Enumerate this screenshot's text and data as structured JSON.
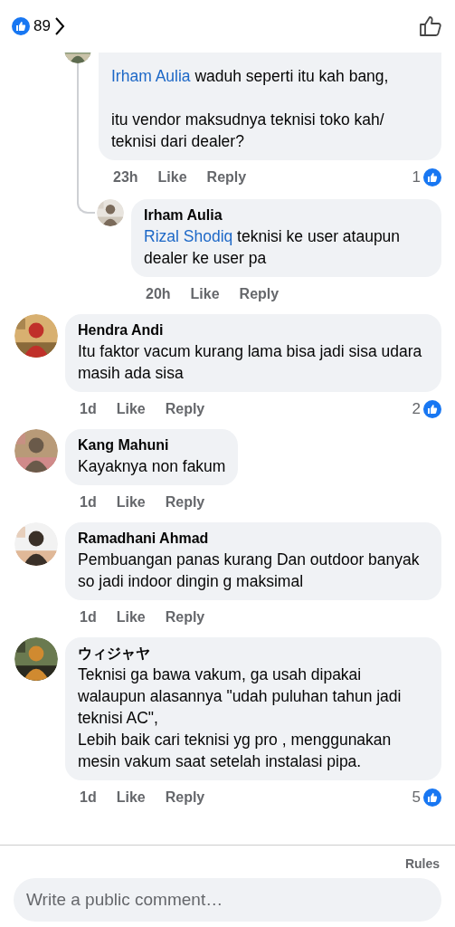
{
  "header": {
    "reaction_count": "89"
  },
  "thread": [
    {
      "mention": "Irham Aulia",
      "text": " waduh seperti itu kah bang,\n\nitu vendor maksudnya teknisi toko kah/ teknisi dari dealer?",
      "time": "23h",
      "actions": [
        "Like",
        "Reply"
      ],
      "reaction_count": "1",
      "children": [
        {
          "name": "Irham Aulia",
          "mention": "Rizal Shodiq",
          "text": " teknisi ke user ataupun dealer ke user pa",
          "time": "20h",
          "actions": [
            "Like",
            "Reply"
          ]
        }
      ]
    }
  ],
  "comments": [
    {
      "name": "Hendra Andi",
      "text": "Itu faktor vacum kurang lama bisa jadi sisa udara masih ada sisa",
      "time": "1d",
      "actions": [
        "Like",
        "Reply"
      ],
      "reaction_count": "2"
    },
    {
      "name": "Kang Mahuni",
      "text": "Kayaknya non fakum",
      "time": "1d",
      "actions": [
        "Like",
        "Reply"
      ]
    },
    {
      "name": "Ramadhani Ahmad",
      "text": "Pembuangan panas kurang Dan outdoor banyak so jadi indoor dingin g maksimal",
      "time": "1d",
      "actions": [
        "Like",
        "Reply"
      ]
    },
    {
      "name": "ウィジャヤ",
      "text": "Teknisi ga bawa vakum, ga usah dipakai walaupun alasannya \"udah puluhan tahun jadi teknisi AC\",\nLebih baik cari teknisi yg pro , menggunakan mesin vakum saat setelah instalasi pipa.",
      "time": "1d",
      "actions": [
        "Like",
        "Reply"
      ],
      "reaction_count": "5"
    }
  ],
  "footer": {
    "rules": "Rules",
    "placeholder": "Write a public comment…"
  }
}
